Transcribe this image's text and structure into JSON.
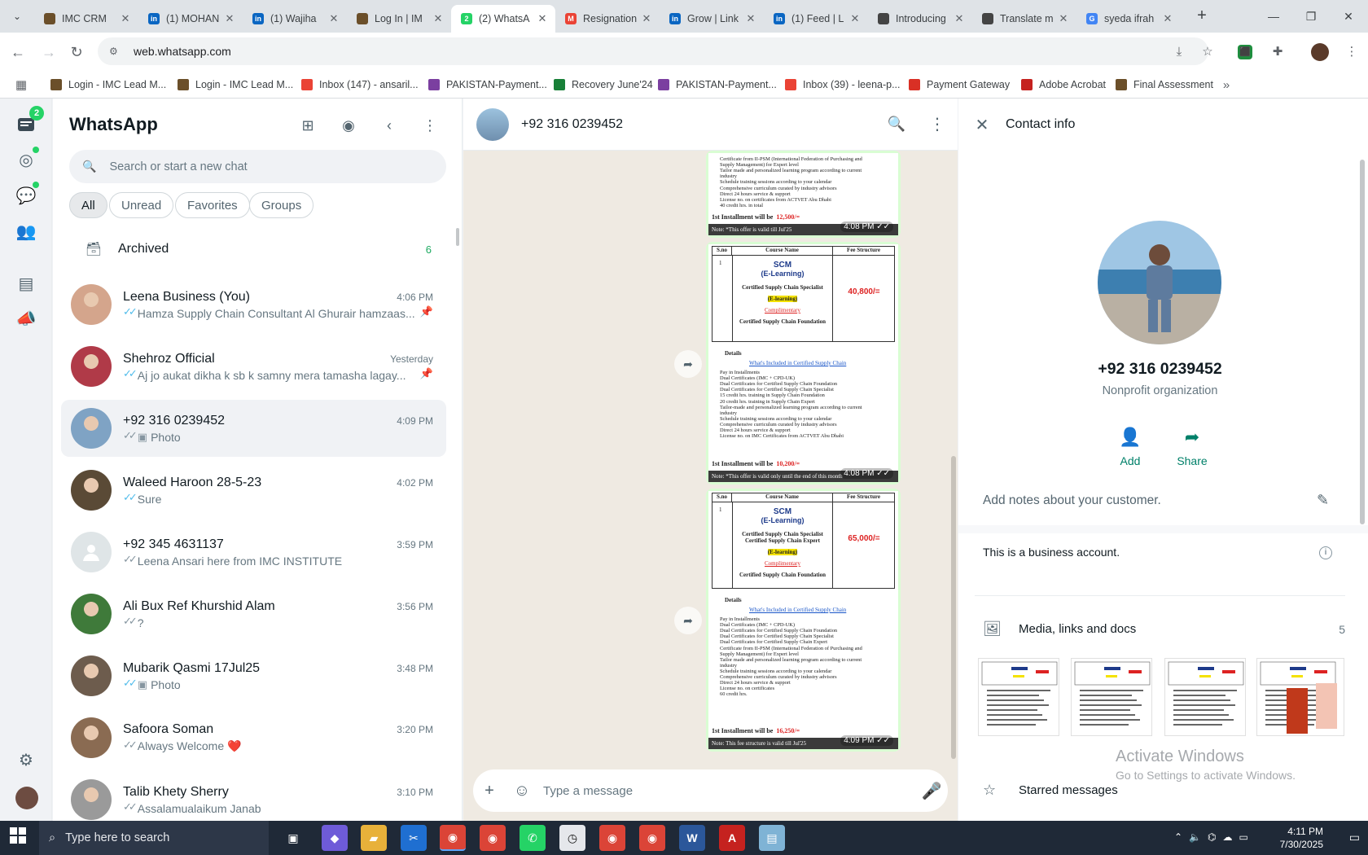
{
  "browser": {
    "tabs": [
      {
        "title": "IMC CRM",
        "color": "#6b4f2a",
        "glyph": "",
        "active": false
      },
      {
        "title": "(1) MOHAN",
        "color": "#0a66c2",
        "glyph": "in",
        "active": false
      },
      {
        "title": "(1) Wajiha",
        "color": "#0a66c2",
        "glyph": "in",
        "active": false
      },
      {
        "title": "Log In | IM",
        "color": "#6b4f2a",
        "glyph": "",
        "active": false
      },
      {
        "title": "(2) WhatsA",
        "color": "#25d366",
        "glyph": "2",
        "active": true
      },
      {
        "title": "Resignation",
        "color": "#ea4335",
        "glyph": "M",
        "active": false
      },
      {
        "title": "Grow | Link",
        "color": "#0a66c2",
        "glyph": "in",
        "active": false
      },
      {
        "title": "(1) Feed | L",
        "color": "#0a66c2",
        "glyph": "in",
        "active": false
      },
      {
        "title": "Introducing",
        "color": "#444",
        "glyph": "",
        "active": false
      },
      {
        "title": "Translate m",
        "color": "#444",
        "glyph": "",
        "active": false
      },
      {
        "title": "syeda ifrah",
        "color": "#4285f4",
        "glyph": "G",
        "active": false
      }
    ],
    "url": "web.whatsapp.com",
    "bookmarks": [
      {
        "label": "Login - IMC Lead M...",
        "color": "#6b4f2a"
      },
      {
        "label": "Login - IMC Lead M...",
        "color": "#6b4f2a"
      },
      {
        "label": "Inbox (147) - ansaril...",
        "color": "#ea4335"
      },
      {
        "label": "PAKISTAN-Payment...",
        "color": "#7b3fa0"
      },
      {
        "label": "Recovery June'24",
        "color": "#188038"
      },
      {
        "label": "PAKISTAN-Payment...",
        "color": "#7b3fa0"
      },
      {
        "label": "Inbox (39) - leena-p...",
        "color": "#ea4335"
      },
      {
        "label": "Payment Gateway",
        "color": "#d93025"
      },
      {
        "label": "Adobe Acrobat",
        "color": "#c5221f"
      },
      {
        "label": "Final Assessment",
        "color": "#6b4f2a"
      }
    ]
  },
  "rail": {
    "chats_badge": "2"
  },
  "sidebar": {
    "title": "WhatsApp",
    "search_placeholder": "Search or start a new chat",
    "filters": [
      "All",
      "Unread",
      "Favorites",
      "Groups"
    ],
    "archived_label": "Archived",
    "archived_count": "6",
    "chats": [
      {
        "name": "Leena Business (You)",
        "time": "4:06 PM",
        "preview": "Hamza Supply Chain Consultant Al Ghurair hamzaas...",
        "tick": "blue",
        "pinned": true,
        "photo": false,
        "avatar": "#d4a58c"
      },
      {
        "name": "Shehroz Official",
        "time": "Yesterday",
        "preview": "Aj jo aukat dikha k sb k samny mera tamasha lagay...",
        "tick": "blue",
        "pinned": true,
        "photo": false,
        "avatar": "#b03a48"
      },
      {
        "name": "+92 316 0239452",
        "time": "4:09 PM",
        "preview": "Photo",
        "tick": "grey",
        "pinned": false,
        "photo": true,
        "avatar": "#7fa3c4",
        "selected": true
      },
      {
        "name": "Waleed Haroon 28-5-23",
        "time": "4:02 PM",
        "preview": "Sure",
        "tick": "blue",
        "pinned": false,
        "photo": false,
        "avatar": "#5a4a36"
      },
      {
        "name": "+92 345 4631137",
        "time": "3:59 PM",
        "preview": "Leena Ansari here from IMC INSTITUTE",
        "tick": "grey",
        "pinned": false,
        "photo": false,
        "avatar": "default"
      },
      {
        "name": "Ali Bux Ref Khurshid Alam",
        "time": "3:56 PM",
        "preview": "?",
        "tick": "grey",
        "pinned": false,
        "photo": false,
        "avatar": "#3f7a3a"
      },
      {
        "name": "Mubarik Qasmi 17Jul25",
        "time": "3:48 PM",
        "preview": "Photo",
        "tick": "blue",
        "pinned": false,
        "photo": true,
        "avatar": "#6d5c4d"
      },
      {
        "name": "Safoora Soman",
        "time": "3:20 PM",
        "preview": "Always Welcome ❤️",
        "tick": "grey",
        "pinned": false,
        "photo": false,
        "avatar": "#8a6b52"
      },
      {
        "name": "Talib Khety Sherry",
        "time": "3:10 PM",
        "preview": "Assalamualaikum Janab",
        "tick": "grey",
        "pinned": false,
        "photo": false,
        "avatar": "#9a9a9a"
      }
    ]
  },
  "conversation": {
    "contact": "+92 316 0239452",
    "message_placeholder": "Type a message",
    "messages": [
      {
        "time": "4:08 PM",
        "lines": [
          "Certificate from II-PSM (International Federation of Purchasing and",
          "Supply Management) for Expert level",
          "Tailor made and personalized learning program according to current",
          "industry",
          "Schedule training sessions according to your calendar",
          "Comprehensive curriculum curated by industry advisors",
          "Direct 24 hours service & support",
          "License no. on certificates from ACTVET Abu Dhabi",
          "40 credit hrs. in total"
        ],
        "installment_label": "1st Installment will be",
        "installment_value": "12,500/=",
        "note": "Note: *This offer is valid till Jul'25"
      },
      {
        "time": "4:08 PM",
        "headers": [
          "S.no",
          "Course Name",
          "Fee Structure"
        ],
        "sno": "1",
        "course_title": "SCM",
        "course_sub": "(E-Learning)",
        "certs": [
          "Certified Supply Chain Specialist"
        ],
        "elearning": "(E-learning)",
        "complimentary": "Complimentary",
        "foundation": "Certified Supply Chain Foundation",
        "fee": "40,800/=",
        "details": "Details",
        "included": "What's Included in Certified Supply Chain",
        "lines": [
          "Pay in Installments",
          "Dual Certificates (IMC + CPD-UK)",
          "Dual Certificates for Certified Supply Chain Foundation",
          "Dual Certificates for Certified Supply Chain Specialist",
          "15 credit hrs. training in Supply Chain Foundation",
          "20 credit hrs. training in Supply Chain Expert",
          "Tailor-made and personalized learning program according to current",
          "industry",
          "Schedule training sessions according to your calendar",
          "Comprehensive curriculum curated by industry advisors",
          "Direct 24 hours service & support",
          "License no. on IMC Certificates from ACTVET Abu Dhabi"
        ],
        "installment_label": "1st Installment will be",
        "installment_value": "10,200/=",
        "note": "Note: *This offer is valid only until the end of this month"
      },
      {
        "time": "4:09 PM",
        "headers": [
          "S.no",
          "Course Name",
          "Fee Structure"
        ],
        "sno": "1",
        "course_title": "SCM",
        "course_sub": "(E-Learning)",
        "certs": [
          "Certified Supply Chain Specialist",
          "Certified Supply Chain Expert"
        ],
        "elearning": "(E-learning)",
        "complimentary": "Complimentary",
        "foundation": "Certified Supply Chain Foundation",
        "fee": "65,000/=",
        "details": "Details",
        "included": "What's Included in Certified Supply Chain",
        "lines": [
          "Pay in Installments",
          "Dual Certificates (IMC + CPD-UK)",
          "Dual Certificates for Certified Supply Chain Foundation",
          "Dual Certificates for Certified Supply Chain Specialist",
          "Dual Certificates for Certified Supply Chain Expert",
          "Certificate from II-PSM (International Federation of Purchasing and",
          "Supply Management) for Expert level",
          "Tailor made and personalized learning program according to current",
          "industry",
          "Schedule training sessions according to your calendar",
          "Comprehensive curriculum curated by industry advisors",
          "Direct 24 hours service & support",
          "License no. on certificates",
          "60 credit hrs."
        ],
        "installment_label": "1st Installment will be",
        "installment_value": "16,250/=",
        "note": "Note: This fee structure is valid till Jul'25"
      }
    ]
  },
  "contact_info": {
    "header": "Contact info",
    "number": "+92 316 0239452",
    "type": "Nonprofit organization",
    "add_label": "Add",
    "share_label": "Share",
    "notes_placeholder": "Add notes about your customer.",
    "business_text": "This is a business account.",
    "media_label": "Media, links and docs",
    "media_count": "5",
    "starred_label": "Starred messages"
  },
  "os": {
    "watermark_title": "Activate Windows",
    "watermark_sub": "Go to Settings to activate Windows.",
    "search_placeholder": "Type here to search",
    "time": "4:11 PM",
    "date": "7/30/2025"
  },
  "colors": {
    "accent": "#008069",
    "bubble": "#d9fdd3",
    "tick_blue": "#53bdeb",
    "badge": "#25d366"
  }
}
